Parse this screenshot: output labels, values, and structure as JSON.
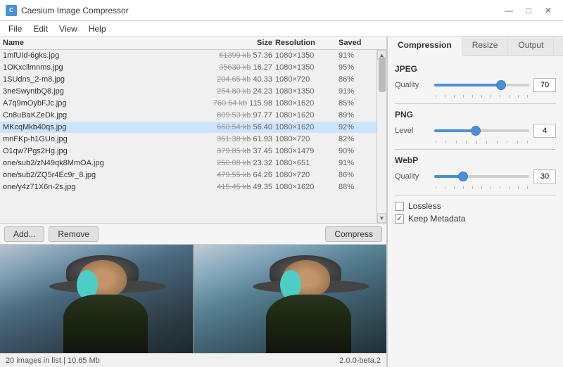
{
  "app": {
    "title": "Caesium Image Compressor",
    "icon": "C"
  },
  "titlebar_controls": {
    "minimize": "—",
    "maximize": "□",
    "close": "✕"
  },
  "menubar": {
    "items": [
      "File",
      "Edit",
      "View",
      "Help"
    ]
  },
  "file_list": {
    "headers": {
      "name": "Name",
      "size": "Size",
      "resolution": "Resolution",
      "saved": "Saved"
    },
    "rows": [
      {
        "name": "1mfUId-6gks.jpg",
        "original": "61399 kb",
        "compressed": "57.36",
        "resolution": "1080×1350",
        "saved": "91%"
      },
      {
        "name": "1OKxcllmnms.jpg",
        "original": "35630 kb",
        "compressed": "16.27",
        "resolution": "1080×1350",
        "saved": "95%"
      },
      {
        "name": "1SUdns_2-m8.jpg",
        "original": "204.65 kb",
        "compressed": "40.33",
        "resolution": "1080×720",
        "saved": "86%"
      },
      {
        "name": "3neSwyntbQ8.jpg",
        "original": "254.80 kb",
        "compressed": "24.23",
        "resolution": "1080×1350",
        "saved": "91%"
      },
      {
        "name": "A7q9mOybFJc.jpg",
        "original": "760.54 kb",
        "compressed": "115.98",
        "resolution": "1080×1620",
        "saved": "85%"
      },
      {
        "name": "Cn8uBaKZeDk.jpg",
        "original": "809.53 kb",
        "compressed": "97.77",
        "resolution": "1080×1620",
        "saved": "89%"
      },
      {
        "name": "MKcqMkb40qs.jpg",
        "original": "660.54 kb",
        "compressed": "56.40",
        "resolution": "1080×1620",
        "saved": "92%",
        "selected": true
      },
      {
        "name": "mnFKp-h1GUo.jpg",
        "original": "351.38 kb",
        "compressed": "61.93",
        "resolution": "1080×720",
        "saved": "82%"
      },
      {
        "name": "O1qw7Pgs2Hg.jpg",
        "original": "379.85 kb",
        "compressed": "37.45",
        "resolution": "1080×1479",
        "saved": "90%"
      },
      {
        "name": "one/sub2/zN49qk8MmOA.jpg",
        "original": "250.08 kb",
        "compressed": "23.32",
        "resolution": "1080×651",
        "saved": "91%"
      },
      {
        "name": "one/sub2/ZQ5r4Ec9r_8.jpg",
        "original": "479.55 kb",
        "compressed": "64.26",
        "resolution": "1080×720",
        "saved": "86%"
      },
      {
        "name": "one/y4z71X6n-2s.jpg",
        "original": "415.45 kb",
        "compressed": "49.35",
        "resolution": "1080×1620",
        "saved": "88%"
      }
    ]
  },
  "toolbar": {
    "add_label": "Add...",
    "remove_label": "Remove",
    "compress_label": "Compress"
  },
  "right_panel": {
    "tabs": [
      "Compression",
      "Resize",
      "Output"
    ],
    "active_tab": "Compression",
    "sections": {
      "jpeg": {
        "label": "JPEG",
        "quality_label": "Quality",
        "quality_value": 70,
        "quality_max": 100,
        "quality_pct": 70
      },
      "png": {
        "label": "PNG",
        "level_label": "Level",
        "level_value": 4,
        "level_max": 9,
        "level_pct": 44
      },
      "webp": {
        "label": "WebP",
        "quality_label": "Quality",
        "quality_value": 30,
        "quality_max": 100,
        "quality_pct": 30
      }
    },
    "lossless_label": "Lossless",
    "lossless_checked": false,
    "keep_metadata_label": "Keep Metadata",
    "keep_metadata_checked": true
  },
  "status_bar": {
    "images_count": "20 images in list",
    "total_size": "10.65 Mb",
    "version": "2.0.0-beta.2"
  }
}
